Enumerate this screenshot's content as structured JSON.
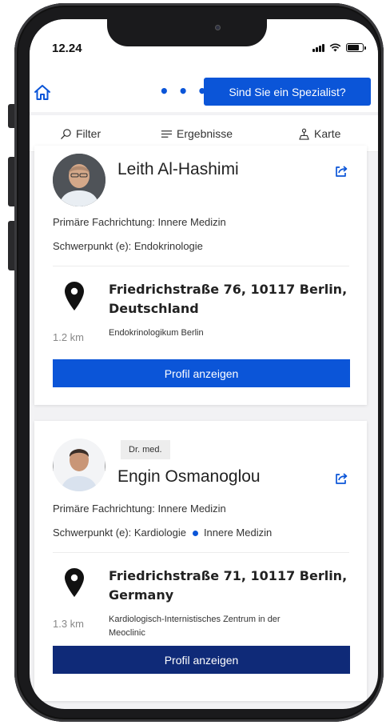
{
  "status_bar": {
    "time": "12.24"
  },
  "header": {
    "menu_dots": "• • •",
    "specialist_button": "Sind Sie ein Spezialist?"
  },
  "tabs": [
    {
      "label": "Filter",
      "icon": "search-icon"
    },
    {
      "label": "Ergebnisse",
      "icon": "list-icon"
    },
    {
      "label": "Karte",
      "icon": "map-pin-person-icon"
    }
  ],
  "results": [
    {
      "title": "",
      "name": "Leith Al-Hashimi",
      "primary_label": "Primäre Fachrichtung:",
      "primary_specialty": "Innere Medizin",
      "focus_label": "Schwerpunkt (e):",
      "focus": [
        "Endokrinologie"
      ],
      "address_line1": "Friedrichstraße 76, 10117 Berlin,",
      "address_line2": "Deutschland",
      "distance": "1.2 km",
      "clinic_line1": "Endokrinologikum Berlin",
      "clinic_line2": "",
      "button": "Profil anzeigen",
      "button_color": "#0b55d8"
    },
    {
      "title": "Dr. med.",
      "name": "Engin Osmanoglou",
      "primary_label": "Primäre Fachrichtung:",
      "primary_specialty": "Innere Medizin",
      "focus_label": "Schwerpunkt (e):",
      "focus": [
        "Kardiologie",
        "Innere Medizin"
      ],
      "address_line1": "Friedrichstraße 71, 10117 Berlin,",
      "address_line2": "Germany",
      "distance": "1.3 km",
      "clinic_line1": "Kardiologisch-Internistisches Zentrum in der",
      "clinic_line2": "Meoclinic",
      "button": "Profil anzeigen",
      "button_color": "#0f2a78"
    }
  ],
  "colors": {
    "accent": "#0b55d8",
    "dark_button": "#0f2a78"
  }
}
